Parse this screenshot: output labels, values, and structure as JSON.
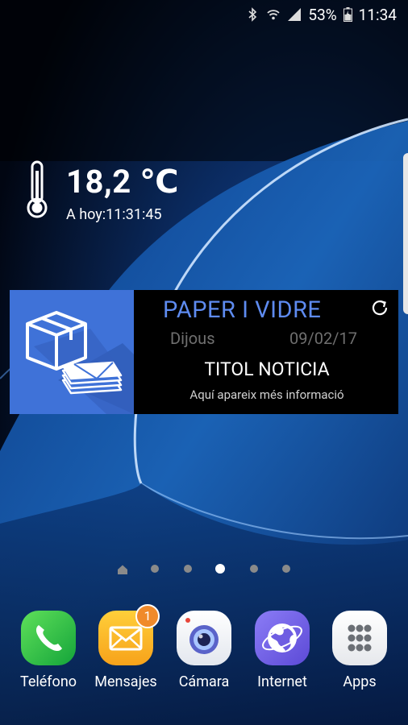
{
  "status_bar": {
    "battery_percent": "53%",
    "time": "11:34",
    "icons": [
      "bluetooth-icon",
      "wifi-icon",
      "signal-icon",
      "battery-icon"
    ]
  },
  "weather_widget": {
    "temperature": "18,2 ℃",
    "updated": "A hoy:11:31:45",
    "icon": "thermometer-icon"
  },
  "recycling_widget": {
    "title": "PAPER I VIDRE",
    "day": "Dijous",
    "date": "09/02/17",
    "news_title": "TITOL NOTICIA",
    "news_info": "Aquí apareix més informació",
    "icons": [
      "package-paper-icon",
      "refresh-icon"
    ],
    "accent_color": "#3f72d8"
  },
  "page_indicator": {
    "pages": 6,
    "current": 4
  },
  "dock": {
    "apps": [
      {
        "label": "Teléfono",
        "icon": "phone-icon"
      },
      {
        "label": "Mensajes",
        "icon": "mail-icon",
        "badge": "1"
      },
      {
        "label": "Cámara",
        "icon": "camera-icon"
      },
      {
        "label": "Internet",
        "icon": "globe-icon"
      },
      {
        "label": "Apps",
        "icon": "apps-grid-icon"
      }
    ]
  }
}
